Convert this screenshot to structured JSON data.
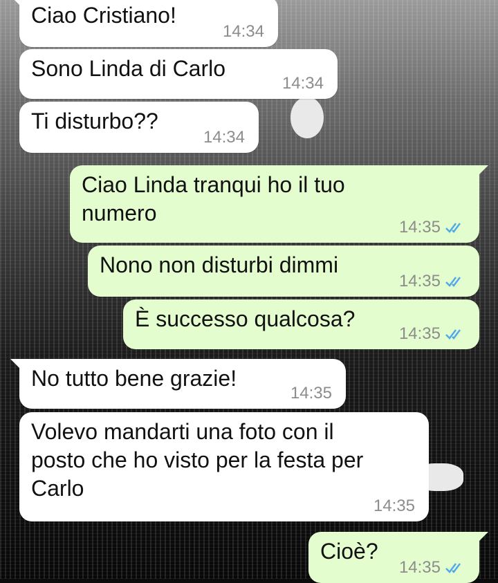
{
  "chat": {
    "messages": [
      {
        "direction": "incoming",
        "text": "Ciao Cristiano!",
        "time": "14:34"
      },
      {
        "direction": "incoming",
        "text": "Sono Linda di Carlo",
        "time": "14:34"
      },
      {
        "direction": "incoming",
        "text": "Ti disturbo??",
        "time": "14:34"
      },
      {
        "direction": "outgoing",
        "text": "Ciao Linda tranqui ho il tuo\nnumero",
        "time": "14:35",
        "status": "read"
      },
      {
        "direction": "outgoing",
        "text": "Nono non disturbi dimmi",
        "time": "14:35",
        "status": "read"
      },
      {
        "direction": "outgoing",
        "text": "È successo qualcosa?",
        "time": "14:35",
        "status": "read"
      },
      {
        "direction": "incoming",
        "text": "No tutto bene grazie!",
        "time": "14:35"
      },
      {
        "direction": "incoming",
        "text": "Volevo mandarti una foto con il\nposto che ho visto per la festa per\nCarlo",
        "time": "14:35"
      },
      {
        "direction": "outgoing",
        "text": "Cioè?",
        "time": "14:35",
        "status": "read"
      }
    ]
  },
  "colors": {
    "incoming_bubble": "#ffffff",
    "outgoing_bubble": "#e4fdcf",
    "timestamp": "#8c8c8c",
    "read_ticks": "#4fa8e8"
  },
  "icons": {
    "read_receipt": "double-check-icon"
  }
}
